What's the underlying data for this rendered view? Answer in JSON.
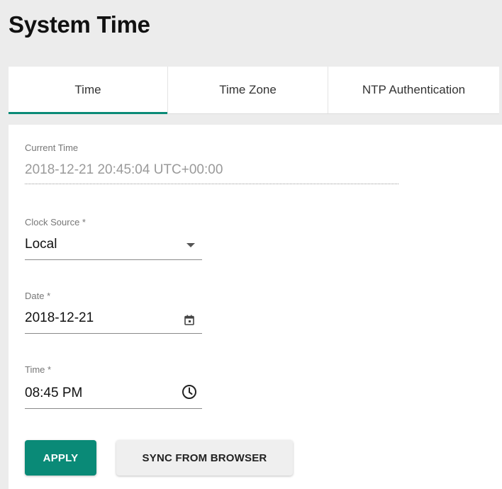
{
  "page": {
    "title": "System Time"
  },
  "tabs": [
    {
      "label": "Time",
      "active": true
    },
    {
      "label": "Time Zone",
      "active": false
    },
    {
      "label": "NTP Authentication",
      "active": false
    }
  ],
  "form": {
    "current_time": {
      "label": "Current Time",
      "value": "2018-12-21 20:45:04 UTC+00:00"
    },
    "clock_source": {
      "label": "Clock Source *",
      "value": "Local",
      "icon": "dropdown-arrow-icon"
    },
    "date": {
      "label": "Date *",
      "value": "2018-12-21",
      "icon": "calendar-icon"
    },
    "time": {
      "label": "Time *",
      "value": "08:45 PM",
      "icon": "clock-icon"
    }
  },
  "buttons": {
    "apply": "APPLY",
    "sync": "SYNC FROM BROWSER"
  },
  "colors": {
    "accent": "#0a8a77"
  }
}
